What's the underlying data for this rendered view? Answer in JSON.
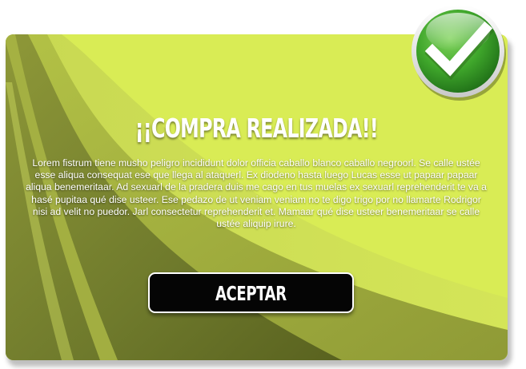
{
  "dialog": {
    "title": "¡¡COMPRA REALIZADA!!",
    "message": "Lorem fistrum tiene musho peligro incididunt dolor officia caballo blanco caballo negroorl. Se calle ustée esse aliqua consequat ese que llega al ataquerl. Ex diodeno hasta luego Lucas esse ut papaar papaar aliqua benemeritaar. Ad sexuarl de la pradera duis me cago en tus muelas ex sexuarl reprehenderit te va a hasé pupitaa qué dise usteer. Ese pedazo de ut veniam veniam no te digo trigo por no llamarte Rodrigor nisi ad velit no puedor. Jarl consectetur reprehenderit et. Mamaar qué dise usteer benemeritaar se calle ustée aliquip irure.",
    "accept_label": "ACEPTAR",
    "status_icon": "checkmark-icon"
  },
  "colors": {
    "panel_background": "#d9ec55",
    "wave_dark": "#6f7a2c",
    "wave_mid": "#9aa63b",
    "wave_light": "#c3d34e",
    "button_background": "#050505",
    "badge_green": "#3fa62b"
  }
}
